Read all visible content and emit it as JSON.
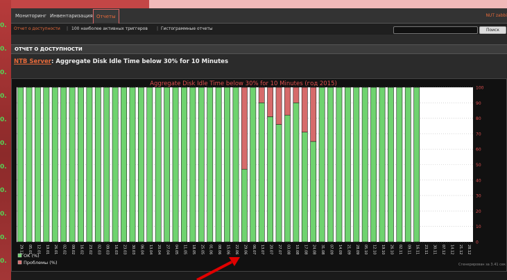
{
  "frame": {
    "ghost_text": "",
    "edge_digits": [
      "0.",
      "0.",
      "0.",
      "0.",
      "0.",
      "0.",
      "0.",
      "0.",
      "0.",
      "0.",
      "0."
    ]
  },
  "nav": {
    "tabs": [
      {
        "label": "Мониторинг"
      },
      {
        "label": "Инвентаризация"
      },
      {
        "label": "Отчеты"
      }
    ],
    "user": "NUT zabbi"
  },
  "subnav": {
    "items": [
      {
        "label": "Отчет о доступности"
      },
      {
        "label": "100 наиболее активных триггеров"
      },
      {
        "label": "Гистограммные отчеты"
      }
    ],
    "search": {
      "placeholder": "",
      "button_label": "Поиск"
    }
  },
  "section": {
    "header": "ОТЧЕТ О ДОСТУПНОСТИ",
    "host": "NTB Server",
    "separator": ":",
    "trigger": "Aggregate Disk Idle Time below 30% for 10 Minutes"
  },
  "colors": {
    "ok": "#6fd36f",
    "problem": "#d66b6b",
    "title": "#e05050",
    "accent": "#e86a3a"
  },
  "chart_data": {
    "type": "bar",
    "stacked": true,
    "title": "Aggregate Disk Idle Time below 30% for 10 Minutes (год 2015)",
    "categories": [
      "29.12",
      "05.01",
      "12.01",
      "19.01",
      "26.01",
      "02.02",
      "09.02",
      "16.02",
      "23.02",
      "02.03",
      "09.03",
      "16.03",
      "23.03",
      "30.03",
      "06.04",
      "13.04",
      "20.04",
      "27.04",
      "04.05",
      "11.05",
      "18.05",
      "25.05",
      "01.06",
      "08.06",
      "15.06",
      "22.06",
      "29.06",
      "06.07",
      "13.07",
      "20.07",
      "27.07",
      "03.08",
      "10.08",
      "17.08",
      "24.08",
      "31.08",
      "07.09",
      "14.09",
      "21.09",
      "28.09",
      "05.10",
      "12.10",
      "19.10",
      "26.10",
      "02.11",
      "09.11",
      "16.11",
      "23.11",
      "30.11",
      "07.12",
      "14.12",
      "21.12",
      "28.12"
    ],
    "series": [
      {
        "name": "OK (%)",
        "values": [
          100,
          100,
          100,
          100,
          100,
          100,
          100,
          100,
          100,
          100,
          100,
          100,
          100,
          100,
          100,
          100,
          100,
          100,
          100,
          100,
          100,
          100,
          100,
          100,
          100,
          100,
          47,
          100,
          90,
          81,
          76,
          82,
          90,
          71,
          65,
          100,
          100,
          100,
          100,
          100,
          100,
          100,
          100,
          100,
          100,
          100,
          100
        ]
      },
      {
        "name": "Проблемы (%)",
        "values": [
          0,
          0,
          0,
          0,
          0,
          0,
          0,
          0,
          0,
          0,
          0,
          0,
          0,
          0,
          0,
          0,
          0,
          0,
          0,
          0,
          0,
          0,
          0,
          0,
          0,
          0,
          53,
          0,
          10,
          19,
          24,
          18,
          10,
          29,
          35,
          0,
          0,
          0,
          0,
          0,
          0,
          0,
          0,
          0,
          0,
          0,
          0
        ]
      }
    ],
    "ylim": [
      0,
      100
    ],
    "yticks": [
      0,
      10,
      20,
      30,
      40,
      50,
      60,
      70,
      80,
      90,
      100
    ],
    "legend": [
      {
        "label": "OK (%)"
      },
      {
        "label": "Проблемы (%)"
      }
    ],
    "legend_position": "bottom-left",
    "footnote": "Сгенерирован за 3.41 сек",
    "grid": true
  }
}
